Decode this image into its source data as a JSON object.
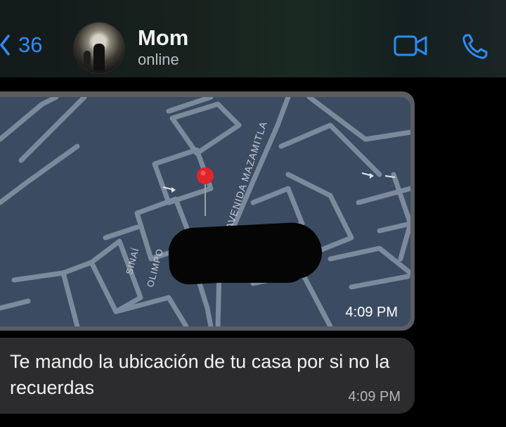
{
  "header": {
    "back_count": "36",
    "contact_name": "Mom",
    "contact_status": "online",
    "icons": [
      "chevron-left-icon",
      "video-icon",
      "phone-icon"
    ],
    "accent_color": "#2f8cf3"
  },
  "messages": [
    {
      "type": "location",
      "streets": [
        "AVENIDA MAZAMITLA",
        "SINAÍ",
        "OLIMPO"
      ],
      "time": "4:09 PM"
    },
    {
      "type": "text",
      "text": "Te mando la ubicación de tu casa por si no la recuerdas",
      "time": "4:09 PM"
    }
  ]
}
